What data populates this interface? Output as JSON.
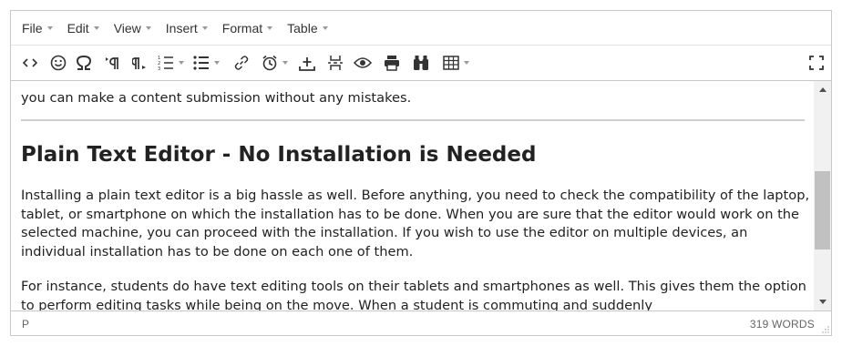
{
  "menubar": {
    "items": [
      {
        "label": "File"
      },
      {
        "label": "Edit"
      },
      {
        "label": "View"
      },
      {
        "label": "Insert"
      },
      {
        "label": "Format"
      },
      {
        "label": "Table"
      }
    ]
  },
  "toolbar": {
    "icons": [
      "code-icon",
      "emoticons-icon",
      "special-char-icon",
      "ltr-icon",
      "rtl-icon",
      "numbered-list-icon",
      "bullet-list-icon",
      "link-icon",
      "insert-time-icon",
      "insert-upload-icon",
      "page-break-icon",
      "preview-icon",
      "print-icon",
      "search-replace-icon",
      "table-icon",
      "fullscreen-icon"
    ]
  },
  "content": {
    "top_text": "you can make a content submission without any mistakes.",
    "heading": "Plain Text Editor - No Installation is Needed",
    "paragraph1": "Installing a plain text editor is a big hassle as well. Before anything, you need to check the compatibility of the laptop, tablet, or smartphone on which the installation has to be done. When you are sure that the editor would work on the selected machine, you can proceed with the installation. If you wish to use the editor on multiple devices, an individual installation has to be done on each one of them.",
    "paragraph2": "For instance, students do have text editing tools on their tablets and smartphones as well. This gives them the option to perform editing tasks while being on the move. When a student is commuting and suddenly"
  },
  "statusbar": {
    "path": "P",
    "word_count": "319 WORDS"
  },
  "colors": {
    "border": "#c8c8c8",
    "text": "#222222",
    "muted": "#666666",
    "scroll_thumb": "#c1c1c1"
  }
}
